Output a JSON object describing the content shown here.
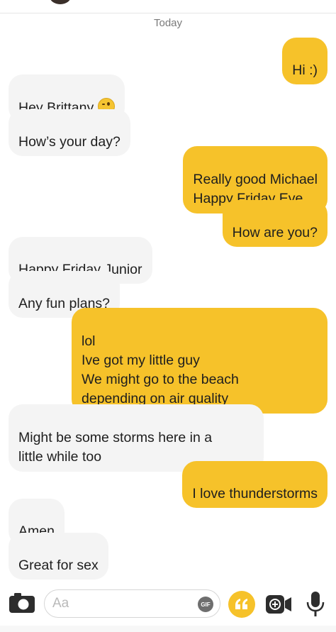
{
  "conversation": {
    "date_divider": "Today",
    "messages": [
      {
        "from": "me",
        "text": "Hi :)"
      },
      {
        "from": "them",
        "text": "Hey Brittany",
        "emoji": "winking-face"
      },
      {
        "from": "them",
        "text": "How’s your day?"
      },
      {
        "from": "me",
        "text": "Really good Michael\nHappy Friday Eve"
      },
      {
        "from": "me",
        "text": "How are you?"
      },
      {
        "from": "them",
        "text": "Happy Friday Junior"
      },
      {
        "from": "them",
        "text": "Any fun plans?"
      },
      {
        "from": "me",
        "text": "lol\nIve got my little guy\nWe might go to the beach\ndepending on air quality"
      },
      {
        "from": "them",
        "text": "Might be some storms here in a\nlittle while too"
      },
      {
        "from": "me",
        "text": "I love thunderstorms"
      },
      {
        "from": "them",
        "text": "Amen"
      },
      {
        "from": "them",
        "text": "Great for sex"
      }
    ]
  },
  "composer": {
    "placeholder": "Aa",
    "gif_label": "GIF",
    "icons": [
      "camera-icon",
      "gif-icon",
      "quote-icon",
      "video-icon",
      "microphone-icon"
    ]
  },
  "colors": {
    "outgoing_bubble": "#f6c22a",
    "incoming_bubble": "#f4f4f4",
    "accent": "#f6c22a"
  }
}
